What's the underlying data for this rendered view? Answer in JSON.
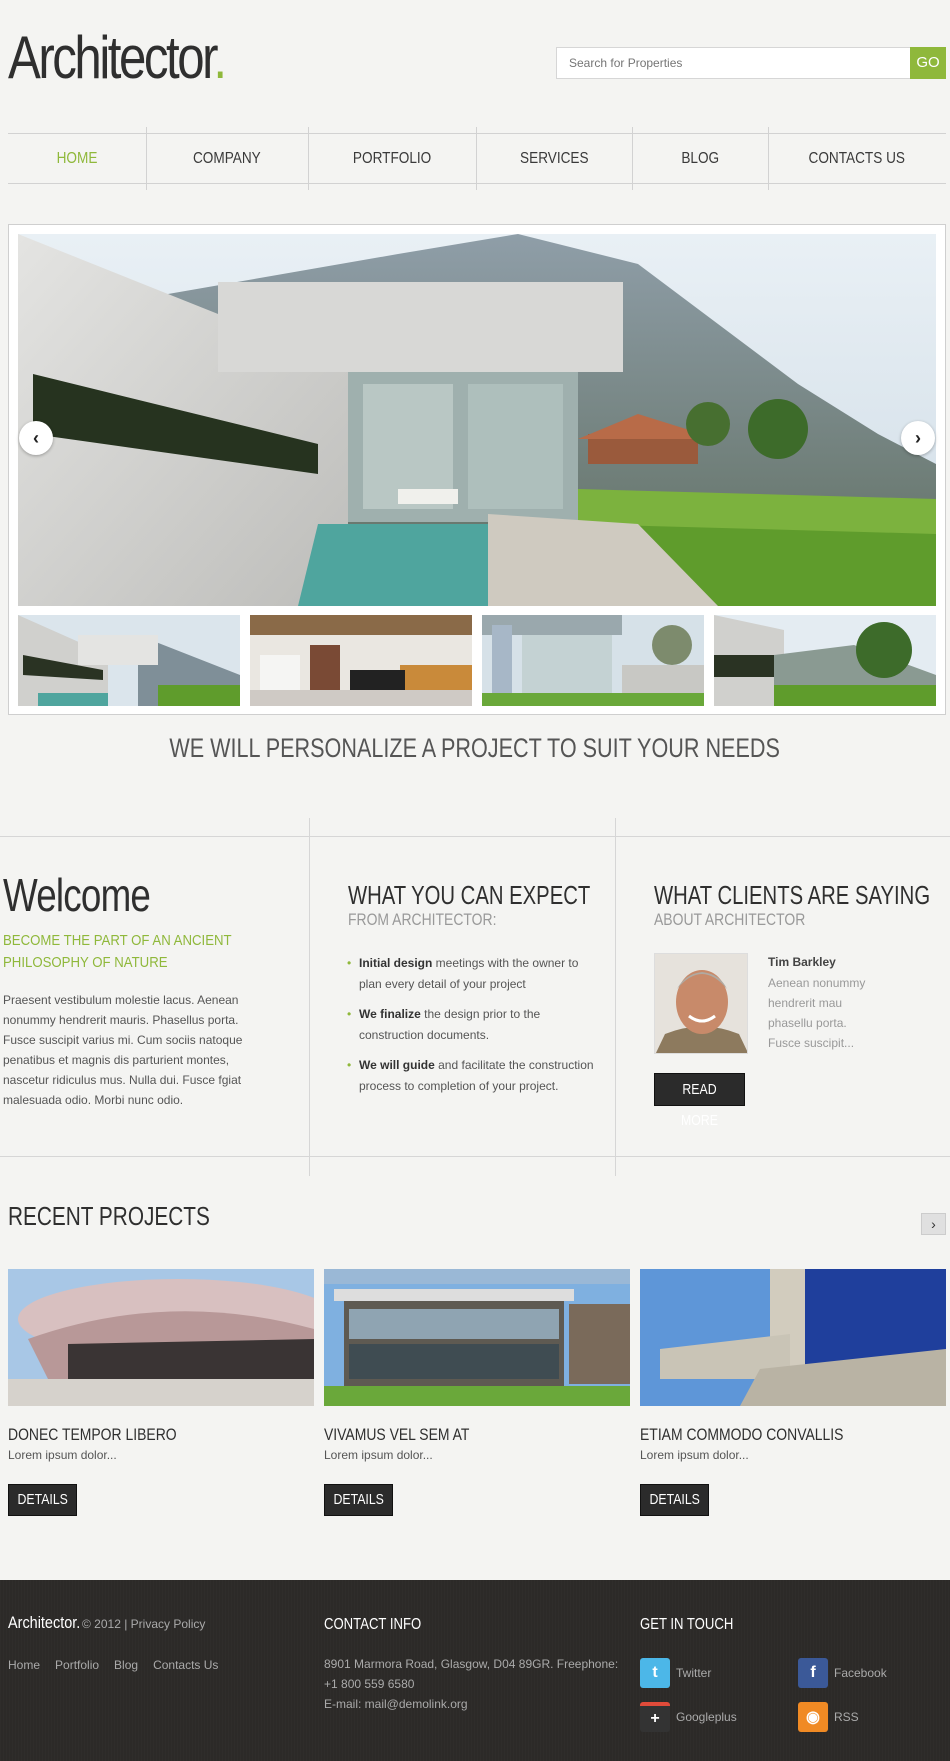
{
  "header": {
    "logo_text": "Architector",
    "logo_dot": ".",
    "search_placeholder": "Search for Properties",
    "search_button": "GO"
  },
  "nav": {
    "items": [
      {
        "label": "HOME",
        "active": true
      },
      {
        "label": "COMPANY"
      },
      {
        "label": "PORTFOLIO"
      },
      {
        "label": "SERVICES"
      },
      {
        "label": "BLOG"
      },
      {
        "label": "CONTACTS US"
      }
    ]
  },
  "slider": {
    "prev_icon": "‹",
    "next_icon": "›"
  },
  "tagline": "WE WILL PERSONALIZE A PROJECT TO SUIT YOUR NEEDS",
  "welcome": {
    "title": "Welcome",
    "subtitle": "BECOME THE PART OF AN ANCIENT PHILOSOPHY OF NATURE",
    "text": "Praesent vestibulum molestie lacus. Aenean nonummy hendrerit mauris. Phasellus porta. Fusce suscipit varius mi. Cum sociis natoque penatibus et magnis dis parturient montes, nascetur ridiculus mus. Nulla dui. Fusce fgiat malesuada odio. Morbi nunc odio."
  },
  "expect": {
    "title": "WHAT YOU CAN EXPECT",
    "subtitle": "FROM ARCHITECTOR:",
    "items": [
      {
        "bold": "Initial design",
        "rest": " meetings with the owner to plan every detail of your project"
      },
      {
        "bold": "We finalize",
        "rest": " the design prior to the construction documents."
      },
      {
        "bold": "We will guide",
        "rest": " and facilitate the construction process to completion of your project."
      }
    ]
  },
  "clients": {
    "title": "WHAT CLIENTS ARE SAYING",
    "subtitle": "ABOUT ARCHITECTOR",
    "name": "Tim Barkley",
    "quote": "Aenean nonummy hendrerit mau phasellu porta. Fusce suscipit...",
    "button": "READ MORE"
  },
  "recent": {
    "title": "RECENT PROJECTS",
    "next_icon": "›",
    "projects": [
      {
        "title": "DONEC TEMPOR LIBERO",
        "desc": "Lorem ipsum dolor...",
        "button": "DETAILS"
      },
      {
        "title": "VIVAMUS VEL SEM AT",
        "desc": "Lorem ipsum dolor...",
        "button": "DETAILS"
      },
      {
        "title": "ETIAM COMMODO CONVALLIS",
        "desc": "Lorem ipsum dolor...",
        "button": "DETAILS"
      }
    ]
  },
  "footer": {
    "logo": "Architector.",
    "copyright": "© 2012 |",
    "privacy": "Privacy Policy",
    "links": [
      "Home",
      "Portfolio",
      "Blog",
      "Contacts Us"
    ],
    "contact_title": "CONTACT INFO",
    "address": "8901 Marmora Road, Glasgow, D04 89GR. Freephone: +1 800 559 6580",
    "email": "E-mail: mail@demolink.org",
    "social_title": "GET IN TOUCH",
    "social": [
      {
        "label": "Twitter",
        "icon": "twitter-icon",
        "color": "#4cb7e8"
      },
      {
        "label": "Facebook",
        "icon": "facebook-icon",
        "color": "#3b5998"
      },
      {
        "label": "Googleplus",
        "icon": "googleplus-icon",
        "color": "#333333"
      },
      {
        "label": "RSS",
        "icon": "rss-icon",
        "color": "#f08a24"
      }
    ]
  },
  "colors": {
    "accent": "#8fb83b",
    "dark": "#2b2b2b",
    "footer_bg": "#2c2a28"
  }
}
